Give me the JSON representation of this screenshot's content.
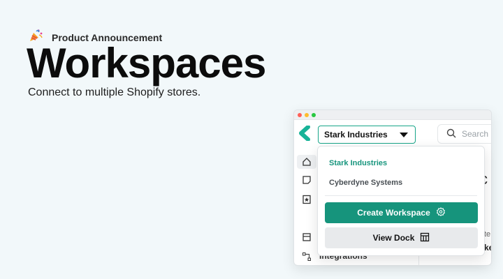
{
  "announcement": {
    "eyebrow": "Product Announcement",
    "icon": "party-popper-icon",
    "title": "Workspaces",
    "subtitle": "Connect to multiple Shopify stores."
  },
  "app": {
    "window_controls": [
      "close",
      "minimize",
      "maximize"
    ],
    "logo": "app-logo-icon",
    "workspace_selector": {
      "value": "Stark Industries"
    },
    "search": {
      "placeholder": "Search",
      "icon": "search-icon"
    },
    "sidebar": {
      "items": [
        {
          "icon": "home-icon",
          "active": true
        },
        {
          "icon": "note-icon"
        },
        {
          "icon": "bookmark-star-icon"
        },
        {
          "icon": "store-icon"
        },
        {
          "icon": "integrations-icon",
          "label": "Integrations"
        }
      ]
    },
    "background_peek": {
      "heading_fragment": "c",
      "line1_fragment": "te",
      "line2_fragment": "ke"
    }
  },
  "dropdown": {
    "workspaces": [
      {
        "label": "Stark Industries",
        "selected": true
      },
      {
        "label": "Cyberdyne Systems",
        "selected": false
      }
    ],
    "create_label": "Create Workspace",
    "create_icon": "gear-icon",
    "dock_label": "View Dock",
    "dock_icon": "dock-layout-icon"
  },
  "colors": {
    "accent": "#16947c",
    "background": "#f2f8fa",
    "window_dots": [
      "#ff5f57",
      "#febc2e",
      "#28c840"
    ]
  }
}
